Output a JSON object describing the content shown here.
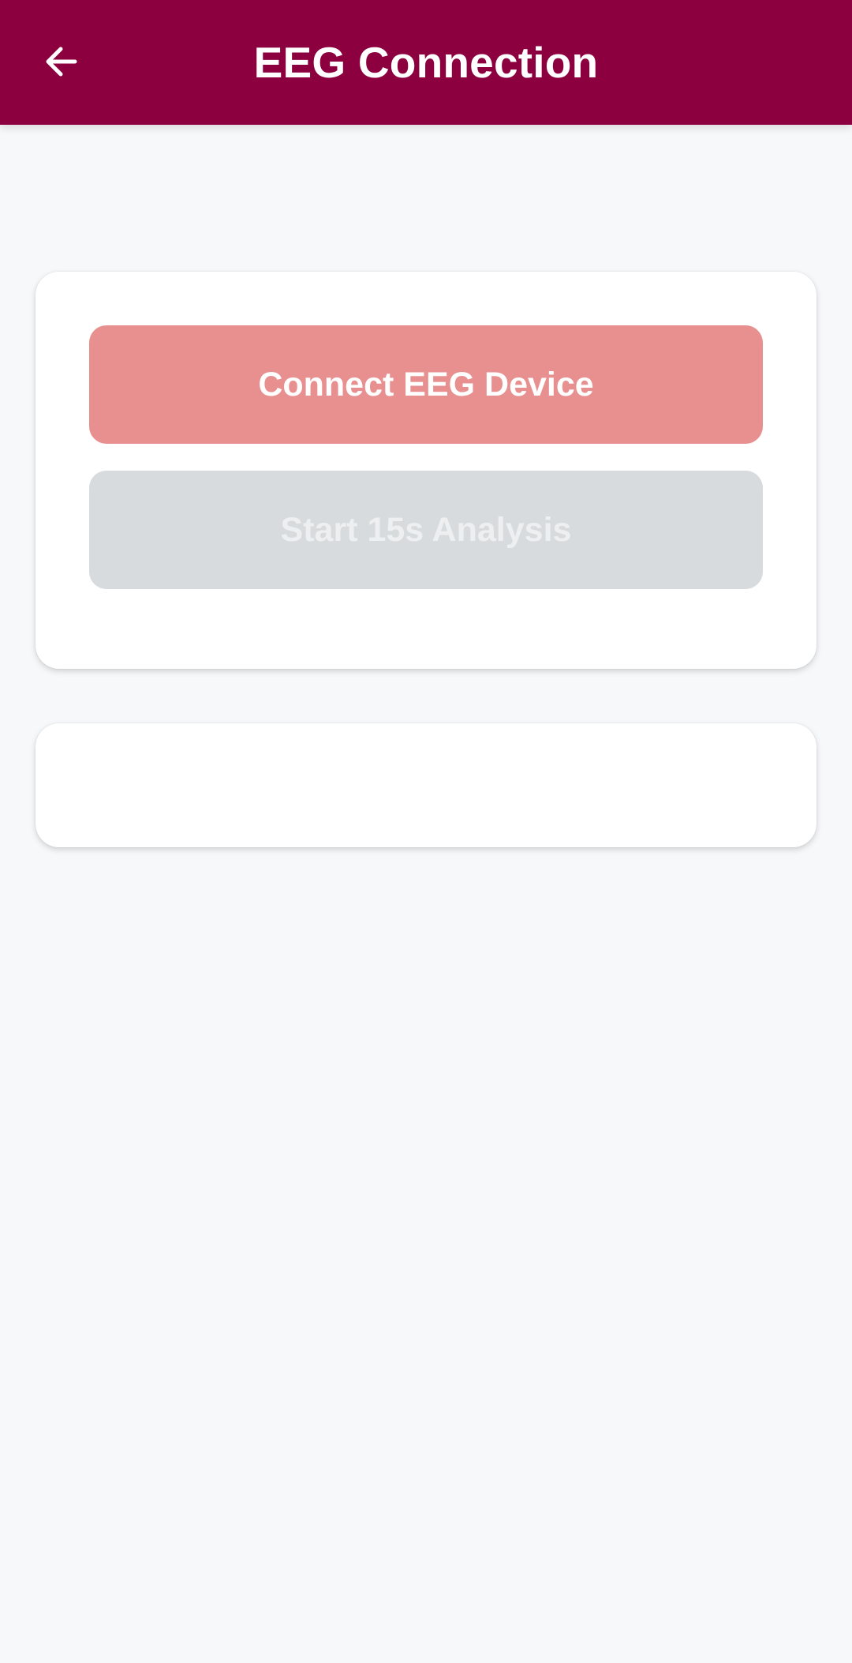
{
  "app_bar": {
    "back_icon": "arrow-left-icon",
    "title": "EEG Connection",
    "background_color": "#8c003f"
  },
  "actions": {
    "connect_button_label": "Connect EEG Device",
    "connect_button_color": "#e89090",
    "analysis_button_label": "Start 15s Analysis",
    "analysis_button_state": "disabled",
    "analysis_button_color": "#d8dbde"
  },
  "status_panel": {
    "text": ""
  }
}
